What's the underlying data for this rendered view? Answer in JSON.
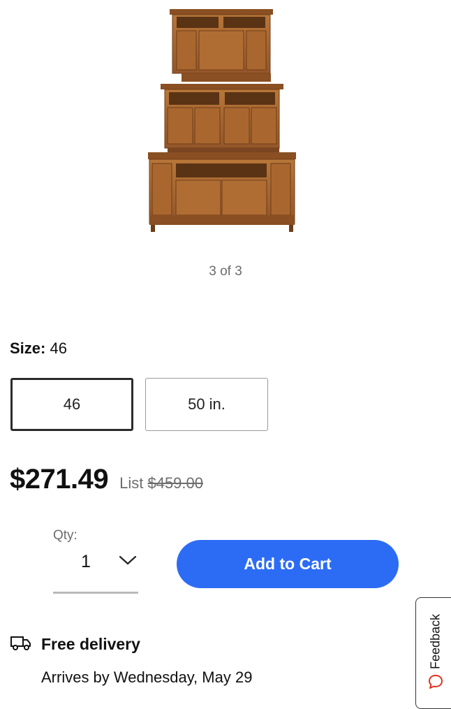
{
  "gallery": {
    "image_alt": "Wooden TV stand with hutch",
    "pager_text": "3 of 3"
  },
  "size": {
    "label": "Size:",
    "selected_value": "46",
    "options": [
      "46",
      "50 in."
    ]
  },
  "pricing": {
    "price": "$271.49",
    "list_label": "List",
    "list_price": "$459.00"
  },
  "quantity": {
    "label": "Qty:",
    "value": "1"
  },
  "cart": {
    "add_to_cart_label": "Add to Cart"
  },
  "delivery": {
    "title": "Free delivery",
    "arrival": "Arrives by Wednesday, May 29"
  },
  "feedback": {
    "label": "Feedback"
  },
  "colors": {
    "accent": "#2c6cf5",
    "wood": "#a8652f"
  },
  "icons": {
    "dropdown": "chevron-down-icon",
    "delivery": "truck-icon",
    "feedback": "speech-bubble-icon"
  }
}
